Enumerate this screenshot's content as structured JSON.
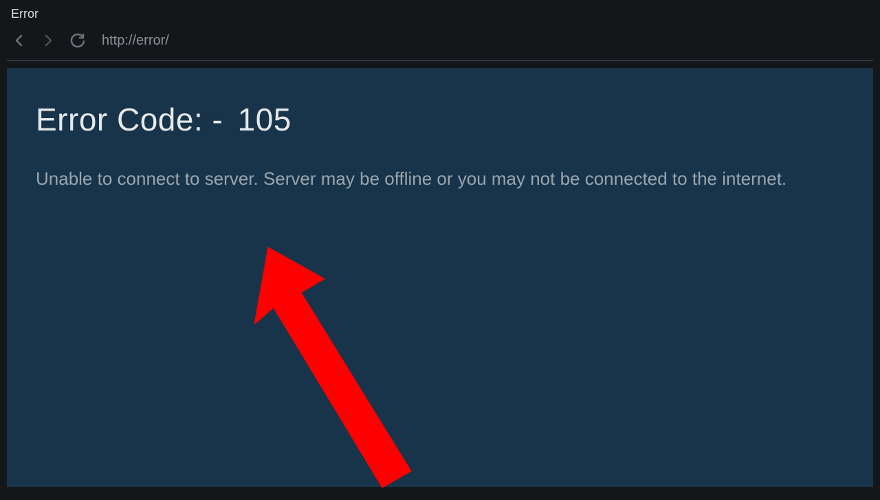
{
  "tab": {
    "title": "Error"
  },
  "navbar": {
    "url": "http://error/"
  },
  "error": {
    "heading_prefix": "Error Code: -",
    "code": "105",
    "message": "Unable to connect to server. Server may be offline or you may not be connected to the internet."
  },
  "colors": {
    "chrome_bg": "#14171a",
    "content_bg": "#18344a",
    "heading_text": "#e6e9eb",
    "body_text": "#9aa5ad",
    "nav_icon": "#6b737b",
    "annotation": "#ff0000"
  }
}
